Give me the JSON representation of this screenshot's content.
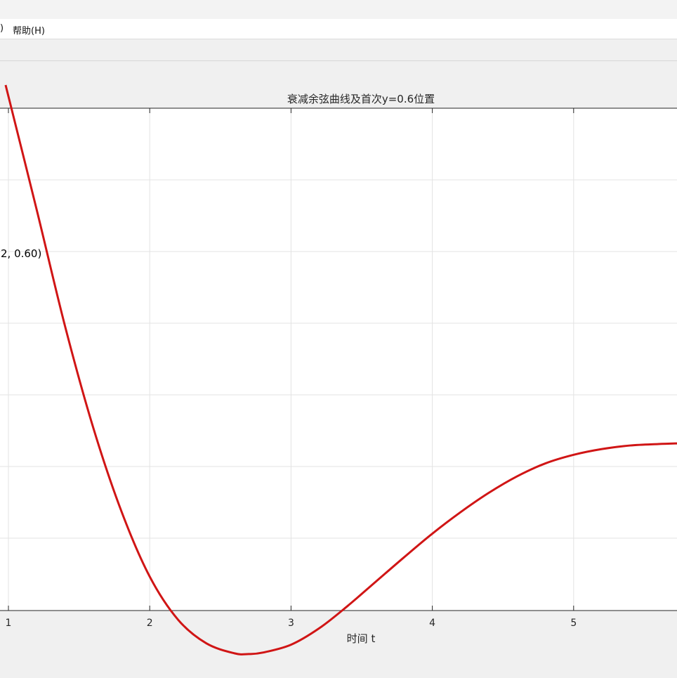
{
  "window": {
    "menu": [
      "帮助(H)"
    ],
    "menu_partial": ")"
  },
  "chart_data": {
    "type": "line",
    "title": "衰减余弦曲线及首次y=0.6位置",
    "xlabel": "时间 t",
    "ylabel": "",
    "xlim": [
      0.98,
      5.75
    ],
    "xticks": [
      1,
      2,
      3,
      4,
      5
    ],
    "xtick_labels": [
      "1",
      "2",
      "3",
      "4",
      "5"
    ],
    "grid": true,
    "series": [
      {
        "color": "#d01515",
        "x": [
          0.98,
          1.2,
          1.4,
          1.6,
          1.8,
          2.0,
          2.2,
          2.4,
          2.6,
          2.7,
          2.8,
          3.0,
          3.2,
          3.4,
          3.6,
          3.8,
          4.0,
          4.2,
          4.4,
          4.6,
          4.8,
          5.0,
          5.2,
          5.4,
          5.6,
          5.75
        ],
        "y": [
          0.5,
          0.326,
          0.164,
          0.022,
          -0.095,
          -0.186,
          -0.246,
          -0.279,
          -0.293,
          -0.294,
          -0.292,
          -0.281,
          -0.258,
          -0.227,
          -0.193,
          -0.159,
          -0.126,
          -0.096,
          -0.069,
          -0.046,
          -0.028,
          -0.016,
          -0.008,
          -0.003,
          -0.001,
          0.0
        ]
      }
    ],
    "annotation": {
      "text": "2, 0.60)"
    }
  }
}
